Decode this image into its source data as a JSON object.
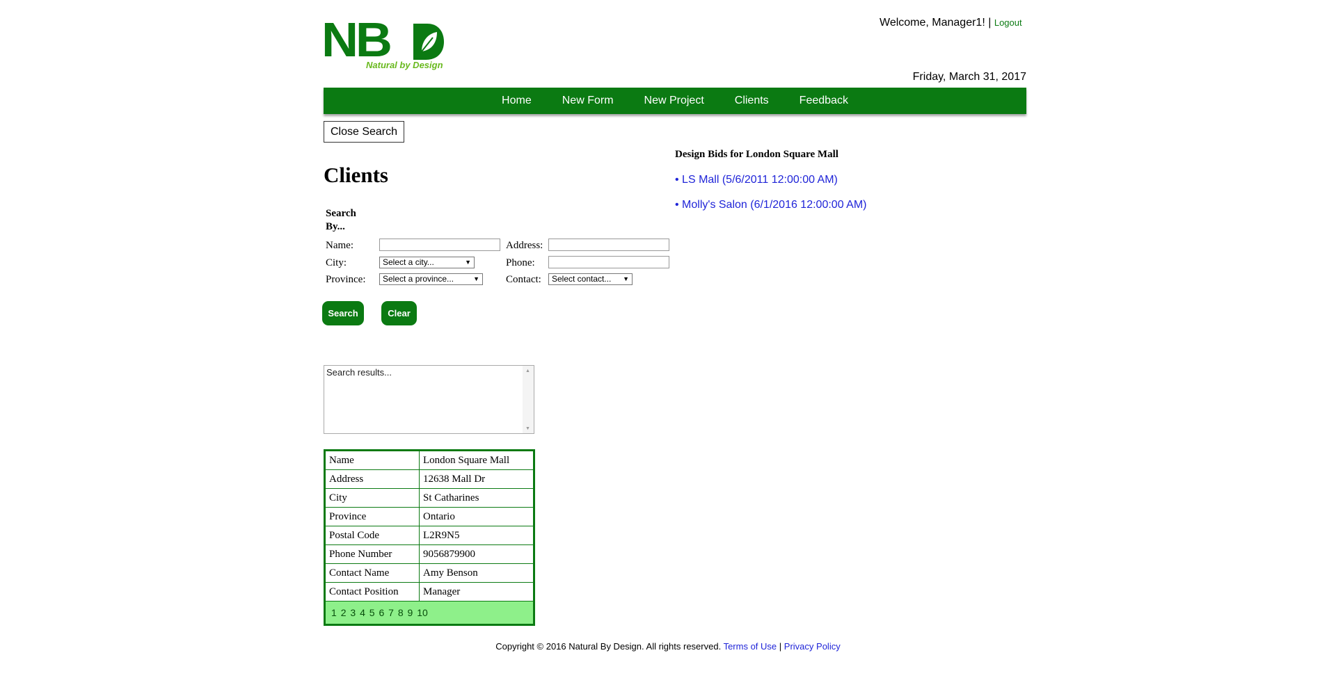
{
  "header": {
    "logo_text": "NBD",
    "logo_tagline": "Natural by Design",
    "welcome": "Welcome, Manager1!",
    "separator": "|",
    "logout": "Logout",
    "date": "Friday, March 31, 2017"
  },
  "nav": {
    "items": [
      "Home",
      "New Form",
      "New Project",
      "Clients",
      "Feedback"
    ]
  },
  "close_search": "Close Search",
  "page_title": "Clients",
  "search": {
    "heading": "Search By...",
    "name_label": "Name:",
    "address_label": "Address:",
    "city_label": "City:",
    "phone_label": "Phone:",
    "province_label": "Province:",
    "contact_label": "Contact:",
    "name_value": "",
    "address_value": "",
    "phone_value": "",
    "city_selected": "Select a city...",
    "province_selected": "Select a province...",
    "contact_selected": "Select contact...",
    "search_button": "Search",
    "clear_button": "Clear",
    "results_placeholder": "Search results..."
  },
  "client_detail": {
    "rows": [
      {
        "key": "Name",
        "value": "London Square Mall"
      },
      {
        "key": "Address",
        "value": "12638 Mall Dr"
      },
      {
        "key": "City",
        "value": "St Catharines"
      },
      {
        "key": "Province",
        "value": "Ontario"
      },
      {
        "key": "Postal Code",
        "value": "L2R9N5"
      },
      {
        "key": "Phone Number",
        "value": "9056879900"
      },
      {
        "key": "Contact Name",
        "value": "Amy Benson"
      },
      {
        "key": "Contact Position",
        "value": "Manager"
      }
    ],
    "pages": [
      "1",
      "2",
      "3",
      "4",
      "5",
      "6",
      "7",
      "8",
      "9",
      "10"
    ]
  },
  "bids": {
    "title": "Design Bids for London Square Mall",
    "items": [
      "• LS Mall (5/6/2011 12:00:00 AM)",
      "• Molly's Salon (6/1/2016 12:00:00 AM)"
    ]
  },
  "footer": {
    "copyright": "Copyright © 2016 Natural By Design. All rights reserved.",
    "terms": "Terms of Use",
    "separator": "|",
    "privacy": "Privacy Policy"
  },
  "colors": {
    "brand_green": "#0b7a12",
    "logo_light_green": "#69b91e",
    "pager_bg": "#8ef08a",
    "link_blue": "#1f24d8"
  }
}
